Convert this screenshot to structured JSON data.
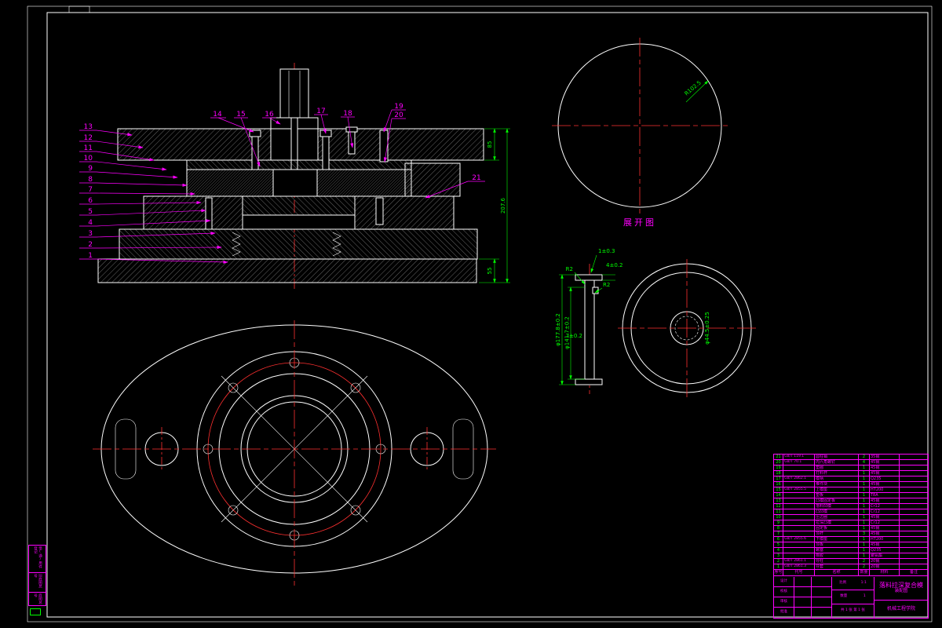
{
  "colors": {
    "bg": "#000000",
    "line": "#ffffff",
    "magenta": "#ff00ff",
    "red": "#ff3030",
    "green": "#00ff00"
  },
  "section": {
    "left_labels": [
      "13",
      "12",
      "11",
      "10",
      "9",
      "8",
      "7",
      "6",
      "5",
      "4",
      "3",
      "2",
      "1"
    ],
    "top_labels": [
      "14",
      "15",
      "16",
      "17",
      "18",
      "19",
      "20"
    ],
    "side_label": "21",
    "dim_top": "85",
    "dim_overall": "207.6",
    "dim_bottom": "55"
  },
  "unfold": {
    "caption": "展开图",
    "radius": "R102.5"
  },
  "profile": {
    "d_thickness": "1±0.3",
    "d_step": "4±0.2",
    "r1": "R2",
    "r2": "R2",
    "dia_outer": "φ177.8±0.2",
    "dia_inner": "φ141.7±0.2",
    "d_height": "7±0.2"
  },
  "ring": {
    "dia_center": "φ44.5±0.25"
  },
  "margin_blocks": [
    "借(通)用件登记",
    "旧底图总号",
    "底图总号"
  ],
  "parts": {
    "headers": [
      "序号",
      "代号",
      "名称",
      "数量",
      "材料",
      "备注"
    ],
    "rows": [
      {
        "no": "21",
        "code": "GB/T 119.1",
        "name": "圆柱销",
        "qty": "2",
        "mat": "35钢",
        "note": ""
      },
      {
        "no": "20",
        "code": "GB/T 70.1",
        "name": "内六角螺钉",
        "qty": "4",
        "mat": "45钢",
        "note": ""
      },
      {
        "no": "19",
        "code": "",
        "name": "垫圈",
        "qty": "1",
        "mat": "45钢",
        "note": ""
      },
      {
        "no": "18",
        "code": "",
        "name": "打料杆",
        "qty": "1",
        "mat": "45钢",
        "note": ""
      },
      {
        "no": "17",
        "code": "GB/T 2862.1",
        "name": "模柄",
        "qty": "1",
        "mat": "Q235",
        "note": ""
      },
      {
        "no": "16",
        "code": "",
        "name": "推件块",
        "qty": "1",
        "mat": "45钢",
        "note": ""
      },
      {
        "no": "15",
        "code": "GB/T 2855.5",
        "name": "上模座",
        "qty": "1",
        "mat": "HT200",
        "note": ""
      },
      {
        "no": "14",
        "code": "",
        "name": "垫板",
        "qty": "1",
        "mat": "T8A",
        "note": ""
      },
      {
        "no": "13",
        "code": "",
        "name": "凸模固定板",
        "qty": "1",
        "mat": "45钢",
        "note": ""
      },
      {
        "no": "12",
        "code": "",
        "name": "落料凹模",
        "qty": "1",
        "mat": "Cr12",
        "note": ""
      },
      {
        "no": "11",
        "code": "",
        "name": "凸凹模",
        "qty": "1",
        "mat": "Cr12",
        "note": ""
      },
      {
        "no": "10",
        "code": "",
        "name": "压边圈",
        "qty": "1",
        "mat": "45钢",
        "note": ""
      },
      {
        "no": "9",
        "code": "",
        "name": "拉深凸模",
        "qty": "1",
        "mat": "Cr12",
        "note": ""
      },
      {
        "no": "8",
        "code": "",
        "name": "固定板",
        "qty": "1",
        "mat": "45钢",
        "note": ""
      },
      {
        "no": "7",
        "code": "",
        "name": "顶杆",
        "qty": "3",
        "mat": "45钢",
        "note": ""
      },
      {
        "no": "6",
        "code": "GB/T 2855.6",
        "name": "下模座",
        "qty": "1",
        "mat": "HT200",
        "note": ""
      },
      {
        "no": "5",
        "code": "",
        "name": "顶板",
        "qty": "1",
        "mat": "45钢",
        "note": ""
      },
      {
        "no": "4",
        "code": "",
        "name": "螺塞",
        "qty": "1",
        "mat": "Q235",
        "note": ""
      },
      {
        "no": "3",
        "code": "",
        "name": "橡胶",
        "qty": "1",
        "mat": "聚氨酯",
        "note": ""
      },
      {
        "no": "2",
        "code": "GB/T 2861.1",
        "name": "导柱",
        "qty": "2",
        "mat": "20钢",
        "note": ""
      },
      {
        "no": "1",
        "code": "GB/T 2861.3",
        "name": "导套",
        "qty": "2",
        "mat": "20钢",
        "note": ""
      }
    ]
  },
  "titleblock": {
    "sign_rows": [
      "设计",
      "校核",
      "审核",
      "批准"
    ],
    "scale_label": "比例",
    "scale": "1:1",
    "qty_label": "数量",
    "qty": "1",
    "sheet": "共 1 张  第 1 张",
    "title": "落料拉深复合模",
    "subtitle": "装配图",
    "org": "机械工程学院"
  }
}
